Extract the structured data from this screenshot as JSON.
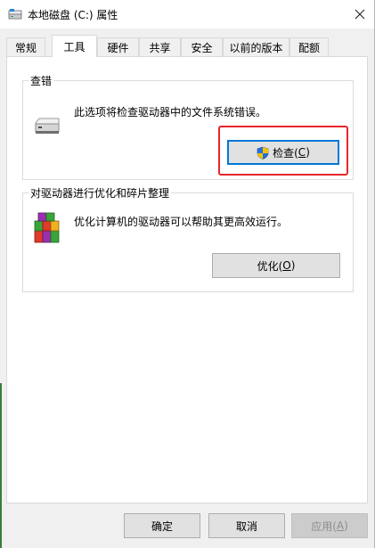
{
  "window": {
    "title": "本地磁盘 (C:) 属性"
  },
  "tabs": [
    {
      "label": "常规",
      "active": false
    },
    {
      "label": "工具",
      "active": true
    },
    {
      "label": "硬件",
      "active": false
    },
    {
      "label": "共享",
      "active": false
    },
    {
      "label": "安全",
      "active": false
    },
    {
      "label": "以前的版本",
      "active": false
    },
    {
      "label": "配额",
      "active": false
    }
  ],
  "error_check": {
    "title": "查错",
    "description": "此选项将检查驱动器中的文件系统错误。",
    "button_label": "检查(",
    "button_key": "C",
    "button_suffix": ")"
  },
  "optimize": {
    "title": "对驱动器进行优化和碎片整理",
    "description": "优化计算机的驱动器可以帮助其更高效运行。",
    "button_label": "优化(",
    "button_key": "O",
    "button_suffix": ")"
  },
  "footer": {
    "ok_label": "确定",
    "cancel_label": "取消",
    "apply_label": "应用(",
    "apply_key": "A",
    "apply_suffix": ")"
  },
  "colors": {
    "highlight": "#e8262b",
    "dialog_bg": "#f0f0f0",
    "panel_bg": "#ffffff"
  }
}
